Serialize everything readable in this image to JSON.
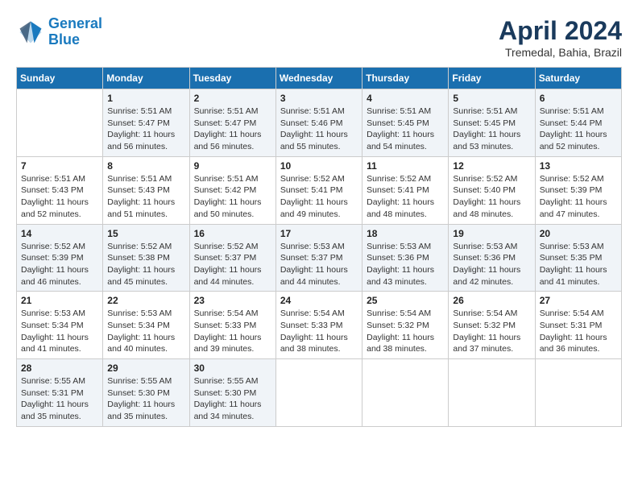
{
  "header": {
    "logo_line1": "General",
    "logo_line2": "Blue",
    "month": "April 2024",
    "location": "Tremedal, Bahia, Brazil"
  },
  "weekdays": [
    "Sunday",
    "Monday",
    "Tuesday",
    "Wednesday",
    "Thursday",
    "Friday",
    "Saturday"
  ],
  "weeks": [
    [
      {
        "day": "",
        "info": ""
      },
      {
        "day": "1",
        "info": "Sunrise: 5:51 AM\nSunset: 5:47 PM\nDaylight: 11 hours\nand 56 minutes."
      },
      {
        "day": "2",
        "info": "Sunrise: 5:51 AM\nSunset: 5:47 PM\nDaylight: 11 hours\nand 56 minutes."
      },
      {
        "day": "3",
        "info": "Sunrise: 5:51 AM\nSunset: 5:46 PM\nDaylight: 11 hours\nand 55 minutes."
      },
      {
        "day": "4",
        "info": "Sunrise: 5:51 AM\nSunset: 5:45 PM\nDaylight: 11 hours\nand 54 minutes."
      },
      {
        "day": "5",
        "info": "Sunrise: 5:51 AM\nSunset: 5:45 PM\nDaylight: 11 hours\nand 53 minutes."
      },
      {
        "day": "6",
        "info": "Sunrise: 5:51 AM\nSunset: 5:44 PM\nDaylight: 11 hours\nand 52 minutes."
      }
    ],
    [
      {
        "day": "7",
        "info": ""
      },
      {
        "day": "8",
        "info": "Sunrise: 5:51 AM\nSunset: 5:43 PM\nDaylight: 11 hours\nand 51 minutes."
      },
      {
        "day": "9",
        "info": "Sunrise: 5:51 AM\nSunset: 5:42 PM\nDaylight: 11 hours\nand 50 minutes."
      },
      {
        "day": "10",
        "info": "Sunrise: 5:52 AM\nSunset: 5:41 PM\nDaylight: 11 hours\nand 49 minutes."
      },
      {
        "day": "11",
        "info": "Sunrise: 5:52 AM\nSunset: 5:41 PM\nDaylight: 11 hours\nand 48 minutes."
      },
      {
        "day": "12",
        "info": "Sunrise: 5:52 AM\nSunset: 5:40 PM\nDaylight: 11 hours\nand 48 minutes."
      },
      {
        "day": "13",
        "info": "Sunrise: 5:52 AM\nSunset: 5:39 PM\nDaylight: 11 hours\nand 47 minutes."
      }
    ],
    [
      {
        "day": "14",
        "info": ""
      },
      {
        "day": "15",
        "info": "Sunrise: 5:52 AM\nSunset: 5:38 PM\nDaylight: 11 hours\nand 45 minutes."
      },
      {
        "day": "16",
        "info": "Sunrise: 5:52 AM\nSunset: 5:37 PM\nDaylight: 11 hours\nand 44 minutes."
      },
      {
        "day": "17",
        "info": "Sunrise: 5:53 AM\nSunset: 5:37 PM\nDaylight: 11 hours\nand 44 minutes."
      },
      {
        "day": "18",
        "info": "Sunrise: 5:53 AM\nSunset: 5:36 PM\nDaylight: 11 hours\nand 43 minutes."
      },
      {
        "day": "19",
        "info": "Sunrise: 5:53 AM\nSunset: 5:36 PM\nDaylight: 11 hours\nand 42 minutes."
      },
      {
        "day": "20",
        "info": "Sunrise: 5:53 AM\nSunset: 5:35 PM\nDaylight: 11 hours\nand 41 minutes."
      }
    ],
    [
      {
        "day": "21",
        "info": ""
      },
      {
        "day": "22",
        "info": "Sunrise: 5:53 AM\nSunset: 5:34 PM\nDaylight: 11 hours\nand 40 minutes."
      },
      {
        "day": "23",
        "info": "Sunrise: 5:54 AM\nSunset: 5:33 PM\nDaylight: 11 hours\nand 39 minutes."
      },
      {
        "day": "24",
        "info": "Sunrise: 5:54 AM\nSunset: 5:33 PM\nDaylight: 11 hours\nand 38 minutes."
      },
      {
        "day": "25",
        "info": "Sunrise: 5:54 AM\nSunset: 5:32 PM\nDaylight: 11 hours\nand 38 minutes."
      },
      {
        "day": "26",
        "info": "Sunrise: 5:54 AM\nSunset: 5:32 PM\nDaylight: 11 hours\nand 37 minutes."
      },
      {
        "day": "27",
        "info": "Sunrise: 5:54 AM\nSunset: 5:31 PM\nDaylight: 11 hours\nand 36 minutes."
      }
    ],
    [
      {
        "day": "28",
        "info": "Sunrise: 5:55 AM\nSunset: 5:31 PM\nDaylight: 11 hours\nand 35 minutes."
      },
      {
        "day": "29",
        "info": "Sunrise: 5:55 AM\nSunset: 5:30 PM\nDaylight: 11 hours\nand 35 minutes."
      },
      {
        "day": "30",
        "info": "Sunrise: 5:55 AM\nSunset: 5:30 PM\nDaylight: 11 hours\nand 34 minutes."
      },
      {
        "day": "",
        "info": ""
      },
      {
        "day": "",
        "info": ""
      },
      {
        "day": "",
        "info": ""
      },
      {
        "day": "",
        "info": ""
      }
    ]
  ],
  "week1_sun_info": "Sunrise: 5:51 AM\nSunset: 5:47 PM\nDaylight: 11 hours\nand 56 minutes.",
  "week2_sun_info": "Sunrise: 5:51 AM\nSunset: 5:43 PM\nDaylight: 11 hours\nand 52 minutes.",
  "week3_sun_info": "Sunrise: 5:52 AM\nSunset: 5:39 PM\nDaylight: 11 hours\nand 46 minutes.",
  "week4_sun_info": "Sunrise: 5:53 AM\nSunset: 5:34 PM\nDaylight: 11 hours\nand 41 minutes."
}
